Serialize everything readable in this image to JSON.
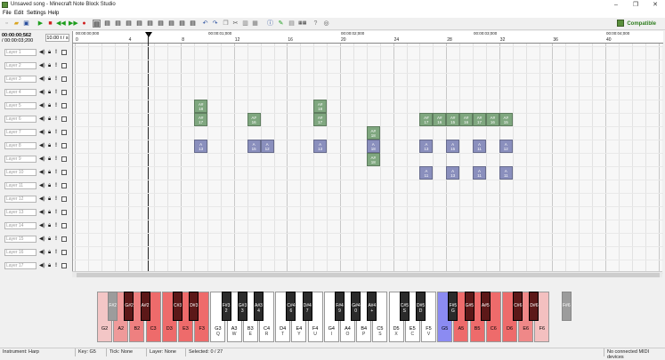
{
  "window": {
    "title": "Unsaved song - Minecraft Note Block Studio",
    "controls": [
      "–",
      "❐",
      "✕"
    ]
  },
  "menu": [
    "File",
    "Edit",
    "Settings",
    "Help"
  ],
  "toolbar": {
    "compat_label": "Compatible",
    "icons": [
      "new-file-icon",
      "open-icon",
      "save-icon",
      "play-icon",
      "stop-icon",
      "rewind-icon",
      "fast-forward-icon",
      "record-icon",
      "select-all-icon",
      "select-mode-1-icon",
      "select-mode-2-icon",
      "select-mode-3-icon",
      "select-mode-4-icon",
      "select-mode-5-icon",
      "select-mode-6-icon",
      "select-mode-7-icon",
      "select-mode-8-icon",
      "undo-icon",
      "redo-icon",
      "copy-icon",
      "cut-icon",
      "paste-icon",
      "delete-icon",
      "info-icon",
      "properties-icon",
      "export-icon",
      "midi-icon",
      "help-icon",
      "website-icon"
    ]
  },
  "song": {
    "time_current": "00:00:00;562",
    "time_total": "/ 00:00:03;200",
    "tempo": "10.00 t / s"
  },
  "layers": [
    "Layer 1",
    "Layer 2",
    "Layer 3",
    "Layer 4",
    "Layer 5",
    "Layer 6",
    "Layer 7",
    "Layer 8",
    "Layer 9",
    "Layer 10",
    "Layer 11",
    "Layer 12",
    "Layer 13",
    "Layer 14",
    "Layer 15",
    "Layer 16",
    "Layer 17"
  ],
  "ruler": {
    "times": [
      "00:00:00;000",
      "00:00:01;000",
      "00:00:02;000",
      "00:00:03;000",
      "00:00:04;000"
    ],
    "ticks": [
      "0",
      "4",
      "8",
      "12",
      "16",
      "20",
      "24",
      "28",
      "32",
      "36",
      "40"
    ]
  },
  "notes": [
    {
      "tick": 9,
      "layer": 5,
      "key": "A#",
      "label": "18",
      "color": "green"
    },
    {
      "tick": 18,
      "layer": 5,
      "key": "A#",
      "label": "18",
      "color": "green"
    },
    {
      "tick": 9,
      "layer": 6,
      "key": "A#",
      "label": "17",
      "color": "green"
    },
    {
      "tick": 13,
      "layer": 6,
      "key": "A#",
      "label": "16",
      "color": "green"
    },
    {
      "tick": 18,
      "layer": 6,
      "key": "A#",
      "label": "17",
      "color": "green"
    },
    {
      "tick": 26,
      "layer": 6,
      "key": "A#",
      "label": "17",
      "color": "green"
    },
    {
      "tick": 27,
      "layer": 6,
      "key": "A#",
      "label": "16",
      "color": "green"
    },
    {
      "tick": 28,
      "layer": 6,
      "key": "A#",
      "label": "15",
      "color": "green"
    },
    {
      "tick": 29,
      "layer": 6,
      "key": "A#",
      "label": "16",
      "color": "green"
    },
    {
      "tick": 30,
      "layer": 6,
      "key": "A#",
      "label": "17",
      "color": "green"
    },
    {
      "tick": 31,
      "layer": 6,
      "key": "A#",
      "label": "16",
      "color": "green"
    },
    {
      "tick": 32,
      "layer": 6,
      "key": "A#",
      "label": "15",
      "color": "green"
    },
    {
      "tick": 22,
      "layer": 7,
      "key": "A#",
      "label": "18",
      "color": "green"
    },
    {
      "tick": 22,
      "layer": 9,
      "key": "A#",
      "label": "18",
      "color": "green"
    },
    {
      "tick": 9,
      "layer": 8,
      "key": "A",
      "label": "13",
      "color": "blue"
    },
    {
      "tick": 13,
      "layer": 8,
      "key": "A",
      "label": "15",
      "color": "blue"
    },
    {
      "tick": 14,
      "layer": 8,
      "key": "A",
      "label": "12",
      "color": "blue"
    },
    {
      "tick": 18,
      "layer": 8,
      "key": "A",
      "label": "13",
      "color": "blue"
    },
    {
      "tick": 22,
      "layer": 8,
      "key": "A",
      "label": "18",
      "color": "blue"
    },
    {
      "tick": 26,
      "layer": 8,
      "key": "A",
      "label": "13",
      "color": "blue"
    },
    {
      "tick": 28,
      "layer": 8,
      "key": "A",
      "label": "15",
      "color": "blue"
    },
    {
      "tick": 30,
      "layer": 8,
      "key": "A",
      "label": "11",
      "color": "blue"
    },
    {
      "tick": 32,
      "layer": 8,
      "key": "A",
      "label": "12",
      "color": "blue"
    },
    {
      "tick": 26,
      "layer": 10,
      "key": "A",
      "label": "11",
      "color": "blue"
    },
    {
      "tick": 28,
      "layer": 10,
      "key": "A",
      "label": "13",
      "color": "blue"
    },
    {
      "tick": 30,
      "layer": 10,
      "key": "A",
      "label": "11",
      "color": "blue"
    },
    {
      "tick": 32,
      "layer": 10,
      "key": "A",
      "label": "11",
      "color": "blue"
    }
  ],
  "piano": {
    "white": [
      {
        "name": "G2",
        "key": "",
        "color": "#f3c6c6"
      },
      {
        "name": "A2",
        "key": "",
        "color": "#ef9a9a"
      },
      {
        "name": "B2",
        "key": "",
        "color": "#ee8080"
      },
      {
        "name": "C3",
        "key": "",
        "color": "#ee6b6b"
      },
      {
        "name": "D3",
        "key": "",
        "color": "#ee6b6b"
      },
      {
        "name": "E3",
        "key": "",
        "color": "#ee6b6b"
      },
      {
        "name": "F3",
        "key": "",
        "color": "#ee6b6b"
      },
      {
        "name": "G3",
        "key": "Q",
        "color": "#ffffff"
      },
      {
        "name": "A3",
        "key": "W",
        "color": "#ffffff"
      },
      {
        "name": "B3",
        "key": "E",
        "color": "#ffffff"
      },
      {
        "name": "C4",
        "key": "R",
        "color": "#ffffff"
      },
      {
        "name": "D4",
        "key": "T",
        "color": "#ffffff"
      },
      {
        "name": "E4",
        "key": "Y",
        "color": "#ffffff"
      },
      {
        "name": "F4",
        "key": "U",
        "color": "#ffffff"
      },
      {
        "name": "G4",
        "key": "I",
        "color": "#ffffff"
      },
      {
        "name": "A4",
        "key": "O",
        "color": "#ffffff"
      },
      {
        "name": "B4",
        "key": "P",
        "color": "#ffffff"
      },
      {
        "name": "C5",
        "key": "S",
        "color": "#ffffff"
      },
      {
        "name": "D5",
        "key": "X",
        "color": "#ffffff"
      },
      {
        "name": "E5",
        "key": "C",
        "color": "#ffffff"
      },
      {
        "name": "F5",
        "key": "V",
        "color": "#ffffff"
      },
      {
        "name": "G5",
        "key": "",
        "color": "#8b8bf2"
      },
      {
        "name": "A5",
        "key": "",
        "color": "#ee6b6b"
      },
      {
        "name": "B5",
        "key": "",
        "color": "#ee6b6b"
      },
      {
        "name": "C6",
        "key": "",
        "color": "#ee6b6b"
      },
      {
        "name": "D6",
        "key": "",
        "color": "#ee6b6b"
      },
      {
        "name": "E6",
        "key": "",
        "color": "#ef8888"
      },
      {
        "name": "F6",
        "key": "",
        "color": "#f3c0c0"
      }
    ],
    "black": [
      {
        "name": "F#2",
        "key": "",
        "after": 0
      },
      {
        "name": "G#2",
        "key": "",
        "after": 1
      },
      {
        "name": "A#2",
        "key": "",
        "after": 2
      },
      {
        "name": "C#3",
        "key": "",
        "after": 4
      },
      {
        "name": "D#3",
        "key": "",
        "after": 5
      },
      {
        "name": "F#3",
        "key": "2",
        "after": 7
      },
      {
        "name": "G#3",
        "key": "3",
        "after": 8
      },
      {
        "name": "A#3",
        "key": "4",
        "after": 9
      },
      {
        "name": "C#4",
        "key": "6",
        "after": 11
      },
      {
        "name": "D#4",
        "key": "7",
        "after": 12
      },
      {
        "name": "F#4",
        "key": "9",
        "after": 14
      },
      {
        "name": "G#4",
        "key": "0",
        "after": 15
      },
      {
        "name": "A#4",
        "key": "+",
        "after": 16
      },
      {
        "name": "C#5",
        "key": "S",
        "after": 18
      },
      {
        "name": "D#5",
        "key": "D",
        "after": 19
      },
      {
        "name": "F#5",
        "key": "G",
        "after": 21
      },
      {
        "name": "G#5",
        "key": "",
        "after": 22
      },
      {
        "name": "A#5",
        "key": "",
        "after": 23
      },
      {
        "name": "C#6",
        "key": "",
        "after": 25
      },
      {
        "name": "D#6",
        "key": "",
        "after": 26
      },
      {
        "name": "F#6",
        "key": "",
        "after": 28
      }
    ]
  },
  "status": {
    "instrument": "Instrument: Harp",
    "key": "Key: G5",
    "tick": "Tick: None",
    "layer": "Layer: None",
    "selected": "Selected: 0 / 27",
    "midi": "No connected MIDI devices"
  }
}
